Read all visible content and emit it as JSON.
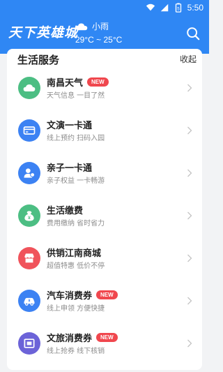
{
  "status_bar": {
    "time": "5:50",
    "battery_level": "5"
  },
  "header": {
    "logo_text": "天下英雄城",
    "weather": {
      "icon": "cloud-icon",
      "description": "小雨",
      "temperature": "29°C ~ 25°C"
    },
    "search_icon": "search-icon"
  },
  "section": {
    "title": "生活服务",
    "collapse_label": "收起"
  },
  "services": [
    {
      "name": "南昌天气",
      "desc": "天气信息  一目了然",
      "new": true,
      "new_label": "NEW",
      "icon": "weather-cloud-icon",
      "color": "#4cbe83"
    },
    {
      "name": "文演一卡通",
      "desc": "线上预约  扫码入园",
      "new": false,
      "new_label": "",
      "icon": "card-icon",
      "color": "#3c82f3"
    },
    {
      "name": "亲子一卡通",
      "desc": "亲子权益  一卡畅游",
      "new": false,
      "new_label": "",
      "icon": "parent-child-icon",
      "color": "#3c82f3"
    },
    {
      "name": "生活缴费",
      "desc": "费用缴纳  省时省力",
      "new": false,
      "new_label": "",
      "icon": "payment-icon",
      "color": "#4cbe83"
    },
    {
      "name": "供销江南商城",
      "desc": "超值特惠  低价不停",
      "new": false,
      "new_label": "",
      "icon": "shop-icon",
      "color": "#f0535b"
    },
    {
      "name": "汽车消费券",
      "desc": "线上申领  方便快捷",
      "new": true,
      "new_label": "NEW",
      "icon": "car-coupon-icon",
      "color": "#3c82f3"
    },
    {
      "name": "文旅消费券",
      "desc": "线上抢券  线下核销",
      "new": true,
      "new_label": "NEW",
      "icon": "travel-coupon-icon",
      "color": "#6c63d8"
    }
  ],
  "colors": {
    "primary": "#2f87f4",
    "badge": "#f0474e",
    "background": "#f2f3f5"
  }
}
